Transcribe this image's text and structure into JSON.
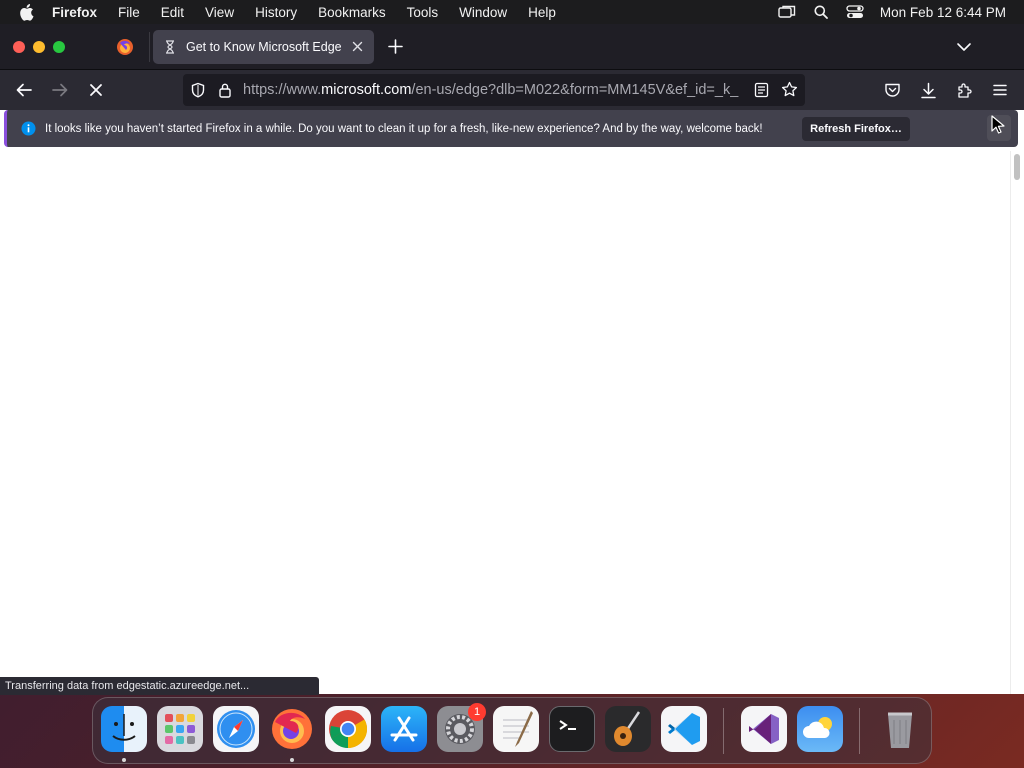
{
  "menubar": {
    "app_name": "Firefox",
    "items": [
      "File",
      "Edit",
      "View",
      "History",
      "Bookmarks",
      "Tools",
      "Window",
      "Help"
    ],
    "clock": "Mon Feb 12  6:44 PM"
  },
  "tabs": {
    "active_title": "Get to Know Microsoft Edge"
  },
  "urlbar": {
    "url_prefix": "https://www.",
    "url_domain": "microsoft.com",
    "url_rest": "/en-us/edge?dlb=M022&form=MM145V&ef_id=_k_"
  },
  "notification": {
    "message": "It looks like you haven’t started Firefox in a while. Do you want to clean it up for a fresh, like-new experience? And by the way, welcome back!",
    "button_label": "Refresh Firefox…"
  },
  "status": {
    "text": "Transferring data from edgestatic.azureedge.net..."
  },
  "dock": {
    "items": [
      "finder-icon",
      "launchpad-icon",
      "safari-icon",
      "firefox-icon",
      "chrome-icon",
      "app-store-icon",
      "system-settings-icon",
      "textedit-icon",
      "terminal-icon",
      "garageband-icon",
      "vscode-icon",
      "visual-studio-icon",
      "weather-icon",
      "trash-icon"
    ],
    "system_settings_badge": "1"
  },
  "colors": {
    "tabstrip_bg": "#1f1e25",
    "toolbar_bg": "#2b2a33",
    "notification_accent": "#8a4fdd",
    "info_blue": "#0090ed"
  }
}
